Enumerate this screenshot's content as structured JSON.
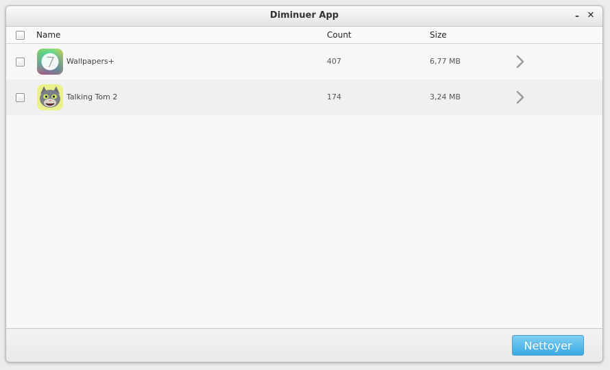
{
  "window": {
    "title": "Diminuer App",
    "minimize_glyph": "–",
    "close_glyph": "✕"
  },
  "table": {
    "columns": {
      "name": "Name",
      "count": "Count",
      "size": "Size"
    },
    "rows": [
      {
        "name": "Wallpapers+",
        "count": "407",
        "size": "6,77 MB",
        "icon": "wallpapers-app-icon"
      },
      {
        "name": "Talking Tom 2",
        "count": "174",
        "size": "3,24 MB",
        "icon": "talking-tom-app-icon"
      }
    ]
  },
  "footer": {
    "clean_label": "Nettoyer"
  },
  "colors": {
    "accent_button": "#3aa9e3",
    "row_alt": "#f0f0f0",
    "background": "#f7f7f7"
  }
}
